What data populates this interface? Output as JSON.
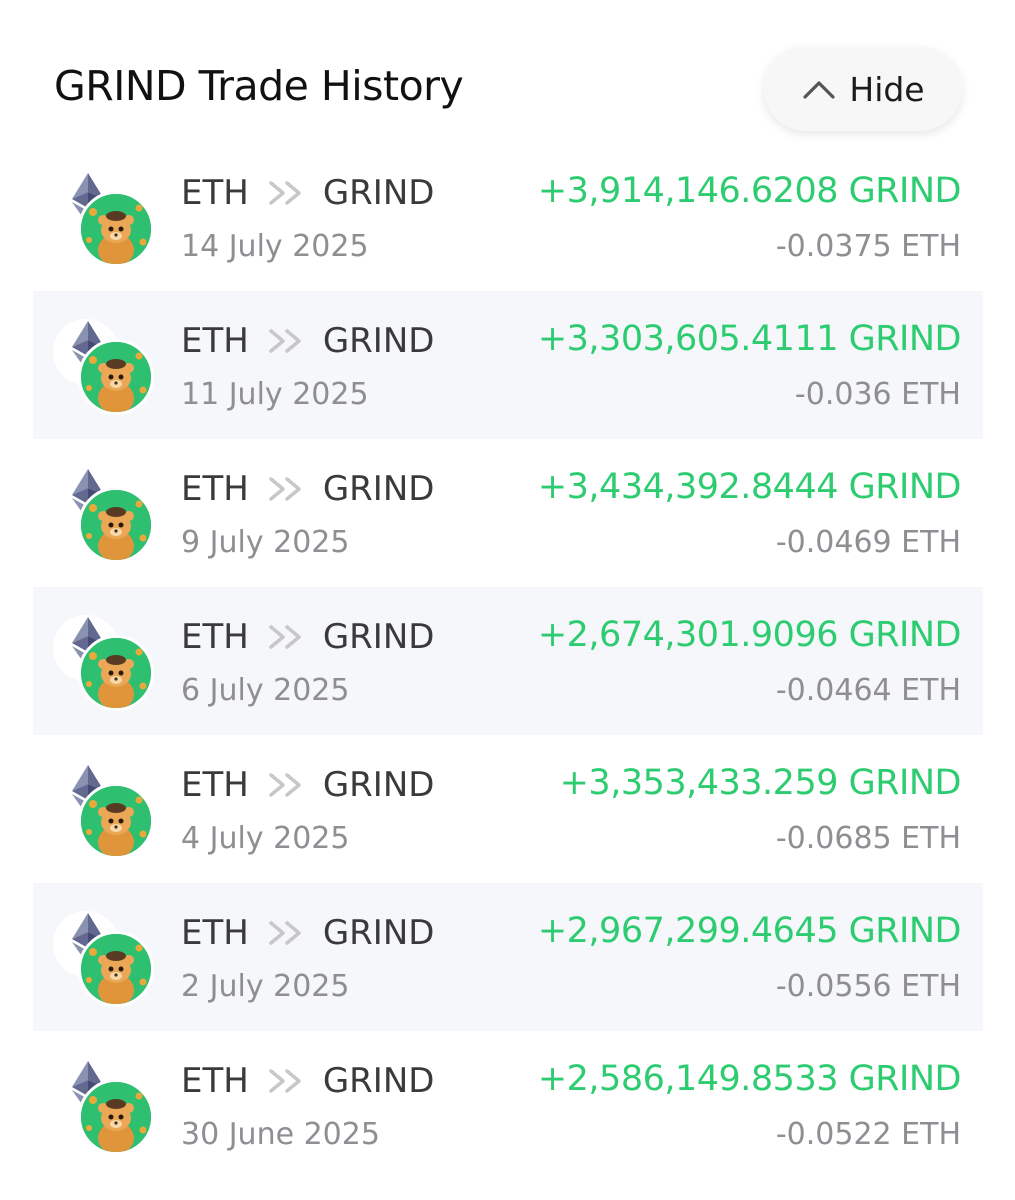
{
  "header": {
    "title": "GRIND Trade History",
    "hide_label": "Hide"
  },
  "colors": {
    "positive": "#2ecc71",
    "muted": "#8e8e93",
    "row_alt_bg": "#f6f7fb",
    "grind_token_bg": "#2fbf71"
  },
  "trades": [
    {
      "from": "ETH",
      "to": "GRIND",
      "date": "14 July 2025",
      "received": "+3,914,146.6208 GRIND",
      "spent": "-0.0375 ETH"
    },
    {
      "from": "ETH",
      "to": "GRIND",
      "date": "11 July 2025",
      "received": "+3,303,605.4111 GRIND",
      "spent": "-0.036 ETH"
    },
    {
      "from": "ETH",
      "to": "GRIND",
      "date": "9 July 2025",
      "received": "+3,434,392.8444 GRIND",
      "spent": "-0.0469 ETH"
    },
    {
      "from": "ETH",
      "to": "GRIND",
      "date": "6 July 2025",
      "received": "+2,674,301.9096 GRIND",
      "spent": "-0.0464 ETH"
    },
    {
      "from": "ETH",
      "to": "GRIND",
      "date": "4 July 2025",
      "received": "+3,353,433.259 GRIND",
      "spent": "-0.0685 ETH"
    },
    {
      "from": "ETH",
      "to": "GRIND",
      "date": "2 July 2025",
      "received": "+2,967,299.4645 GRIND",
      "spent": "-0.0556 ETH"
    },
    {
      "from": "ETH",
      "to": "GRIND",
      "date": "30 June 2025",
      "received": "+2,586,149.8533 GRIND",
      "spent": "-0.0522 ETH"
    }
  ],
  "icons": {
    "from_token": "ethereum-icon",
    "to_token": "grind-token-icon",
    "pair_separator": "double-chevron-right-icon",
    "hide": "chevron-up-icon"
  }
}
